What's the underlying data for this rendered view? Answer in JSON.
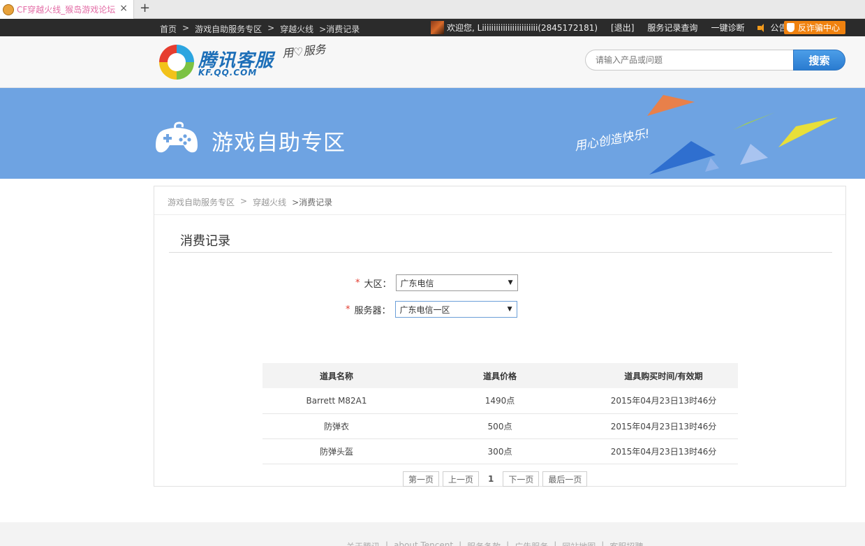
{
  "browser": {
    "tab_title": "CF穿越火线_猴岛游戏论坛",
    "tab_close": "×",
    "new_tab": "+"
  },
  "topbar": {
    "crumbs": [
      "首页",
      "游戏自助服务专区",
      "穿越火线"
    ],
    "crumb_current": ">消费记录",
    "crumb_separator": ">",
    "welcome": "欢迎您, Liiiiiiiiiiiiiiiiiiiiiiii(2845172181)",
    "logout": "[退出]",
    "service_records": "服务记录查询",
    "diagnose": "一键诊断",
    "notice": "公告",
    "fraud_center": "反诈骗中心"
  },
  "header": {
    "logo_text": "腾讯客服",
    "logo_sub": "KF.QQ.COM",
    "slogan": "用♡服务",
    "search_placeholder": "请输入产品或问题",
    "search_button": "搜索"
  },
  "banner": {
    "title": "游戏自助专区",
    "slogan": "用心创造快乐!",
    "colors": {
      "background": "#6ea3e2"
    }
  },
  "content": {
    "crumbs": [
      "游戏自助服务专区",
      "穿越火线"
    ],
    "crumb_current": ">消费记录",
    "crumb_separator": ">",
    "section_title": "消费记录",
    "form": {
      "region_label": "大区：",
      "region_value": "广东电信",
      "server_label": "服务器：",
      "server_value": "广东电信一区",
      "required_mark": "*"
    },
    "table": {
      "headers": [
        "道具名称",
        "道具价格",
        "道具购买时间/有效期"
      ],
      "rows": [
        [
          "Barrett M82A1",
          "1490点",
          "2015年04月23日13时46分"
        ],
        [
          "防弹衣",
          "500点",
          "2015年04月23日13时46分"
        ],
        [
          "防弹头盔",
          "300点",
          "2015年04月23日13时46分"
        ]
      ]
    },
    "pager": {
      "first": "第一页",
      "prev": "上一页",
      "current": "1",
      "next": "下一页",
      "last": "最后一页"
    }
  },
  "footer": {
    "links": [
      "关于腾讯",
      "about Tencent",
      "服务条款",
      "广告服务",
      "网站地图",
      "客服招聘"
    ],
    "separator": "|"
  }
}
